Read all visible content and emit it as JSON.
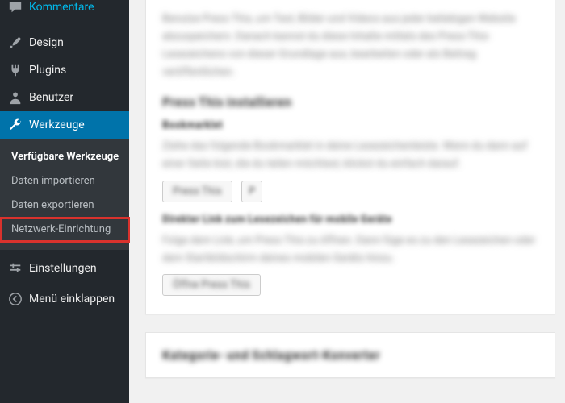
{
  "sidebar": {
    "items": [
      {
        "label": "Kommentare",
        "icon": "comment-icon"
      },
      {
        "label": "Design",
        "icon": "brush-icon"
      },
      {
        "label": "Plugins",
        "icon": "plug-icon"
      },
      {
        "label": "Benutzer",
        "icon": "user-icon"
      },
      {
        "label": "Werkzeuge",
        "icon": "wrench-icon"
      },
      {
        "label": "Einstellungen",
        "icon": "sliders-icon"
      }
    ],
    "submenu": {
      "items": [
        {
          "label": "Verfügbare Werkzeuge"
        },
        {
          "label": "Daten importieren"
        },
        {
          "label": "Daten exportieren"
        },
        {
          "label": "Netzwerk-Einrichtung"
        }
      ]
    },
    "collapse_label": "Menü einklappen"
  },
  "content": {
    "card1": {
      "para1": "Benutze Press This, um Text, Bilder und Videos aus jeder beliebigen Website abzuspeichern. Danach kannst du diese Inhalte mittels des Press-This-Lesezeichens von dieser Grundlage aus, bearbeiten oder als Beitrag veröffentlichen.",
      "heading1": "Press This installieren",
      "strong1": "Bookmarklet",
      "para2": "Ziehe das folgende Bookmarklet in deine Lesezeichenleiste. Wenn du dann auf einer Seite bist, die du teilen möchtest, klickst du einfach darauf.",
      "btn1": "Press This",
      "strong2": "Direkter Link zum Lesezeichen für mobile Geräte",
      "para3": "Folge dem Link, um Press This zu öffnen. Dann füge es zu den Lesezeichen oder dem Startbildschirm deines mobilen Geräts hinzu.",
      "btn2": "Öffne Press This"
    },
    "card2": {
      "heading": "Kategorie- und Schlagwort-Konverter"
    }
  },
  "colors": {
    "accent": "#0073aa",
    "highlight": "#d9322d"
  }
}
